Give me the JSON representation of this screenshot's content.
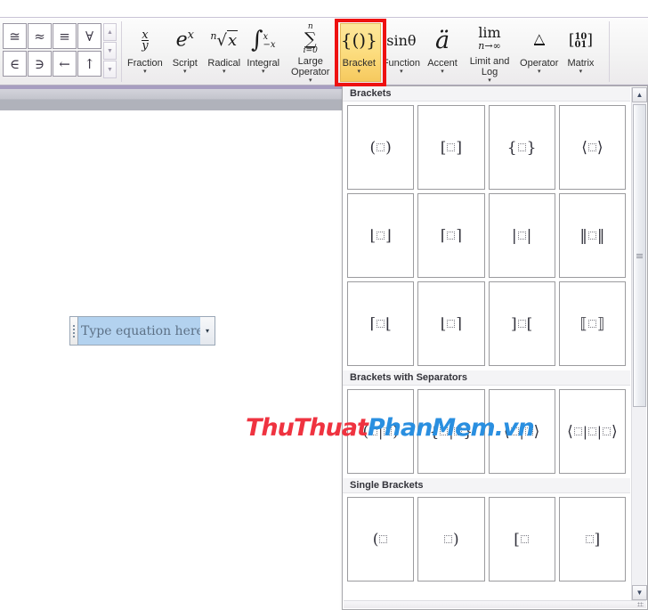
{
  "ribbon": {
    "symbols": [
      "≅",
      "≈",
      "≡",
      "∀",
      "∈",
      "∋",
      "←",
      "↑"
    ],
    "scroll_up_icon": "▲",
    "scroll_down_icon": "▼",
    "scroll_more_icon": "▼",
    "structures": [
      {
        "glyph": "x⁄y",
        "label": "Fraction",
        "caret": "▾",
        "name": "fraction"
      },
      {
        "glyph": "eˣ",
        "label": "Script",
        "caret": "▾",
        "name": "script"
      },
      {
        "glyph": "ⁿ√x",
        "label": "Radical",
        "caret": "▾",
        "name": "radical"
      },
      {
        "glyph": "∫",
        "label": "Integral",
        "caret": "▾",
        "name": "integral"
      },
      {
        "glyph": "∑",
        "label": "Large Operator",
        "caret": "▾",
        "name": "large-operator"
      },
      {
        "glyph": "{()}",
        "label": "Bracket",
        "caret": "▾",
        "name": "bracket"
      },
      {
        "glyph": "sinθ",
        "label": "Function",
        "caret": "▾",
        "name": "function"
      },
      {
        "glyph": "ä",
        "label": "Accent",
        "caret": "▾",
        "name": "accent"
      },
      {
        "glyph": "lim",
        "label": "Limit and Log",
        "caret": "▾",
        "name": "limit-and-log"
      },
      {
        "glyph": "△",
        "label": "Operator",
        "caret": "▾",
        "name": "operator"
      },
      {
        "glyph": "[10 01]",
        "label": "Matrix",
        "caret": "▾",
        "name": "matrix"
      }
    ]
  },
  "document": {
    "equation": {
      "placeholder_text": "Type equation here.",
      "dropdown_icon": "▾",
      "selected": true
    },
    "watermark": {
      "part1": "ThuThuat",
      "part2": "PhanMem.vn",
      "color1": "#ef3340",
      "color2": "#2a8fe0"
    }
  },
  "gallery": {
    "scrollbar": {
      "up_icon": "▲",
      "down_icon": "▼"
    },
    "sections": [
      {
        "title": "Brackets",
        "name": "section-brackets",
        "items": [
          {
            "name": "paren-pair",
            "open": "(",
            "close": ")",
            "mid": ""
          },
          {
            "name": "square-pair",
            "open": "[",
            "close": "]",
            "mid": ""
          },
          {
            "name": "curly-pair",
            "open": "{",
            "close": "}",
            "mid": ""
          },
          {
            "name": "angle-pair",
            "open": "⟨",
            "close": "⟩",
            "mid": ""
          },
          {
            "name": "floor-pair",
            "open": "⌊",
            "close": "⌋",
            "mid": ""
          },
          {
            "name": "ceil-pair",
            "open": "⌈",
            "close": "⌉",
            "mid": ""
          },
          {
            "name": "abs-pair",
            "open": "|",
            "close": "|",
            "mid": ""
          },
          {
            "name": "norm-pair",
            "open": "‖",
            "close": "‖",
            "mid": ""
          },
          {
            "name": "ceil-floor-pair",
            "open": "⌈",
            "close": "⌊",
            "mid": ""
          },
          {
            "name": "floor-ceil-pair",
            "open": "⌊",
            "close": "⌉",
            "mid": ""
          },
          {
            "name": "reverse-square-pair",
            "open": "]",
            "close": "[",
            "mid": ""
          },
          {
            "name": "double-square-pair",
            "open": "⟦",
            "close": "⟧",
            "mid": ""
          }
        ]
      },
      {
        "title": "Brackets with Separators",
        "name": "section-brackets-separators",
        "items": [
          {
            "name": "paren-sep",
            "open": "(",
            "close": ")",
            "mid": "|"
          },
          {
            "name": "curly-sep",
            "open": "{",
            "close": "}",
            "mid": "|"
          },
          {
            "name": "angle-sep",
            "open": "⟨",
            "close": "⟩",
            "mid": "|"
          },
          {
            "name": "angle-double-sep",
            "open": "⟨",
            "close": "⟩",
            "mid": "||"
          }
        ]
      },
      {
        "title": "Single Brackets",
        "name": "section-single-brackets",
        "items": [
          {
            "name": "single-open-paren",
            "open": "(",
            "close": "",
            "mid": ""
          },
          {
            "name": "single-close-paren",
            "open": "",
            "close": ")",
            "mid": ""
          },
          {
            "name": "single-open-square",
            "open": "[",
            "close": "",
            "mid": ""
          },
          {
            "name": "single-close-square",
            "open": "",
            "close": "]",
            "mid": ""
          }
        ]
      }
    ]
  }
}
